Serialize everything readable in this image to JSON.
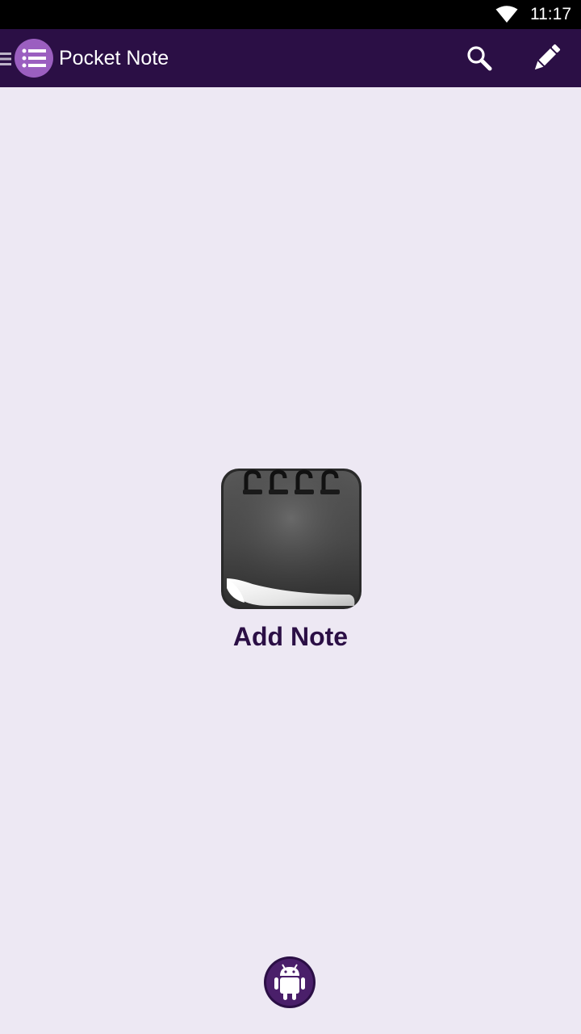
{
  "status_bar": {
    "time": "11:17",
    "icons": [
      "wifi-icon"
    ]
  },
  "app_bar": {
    "title": "Pocket Note",
    "logo_icon": "list-icon",
    "actions": [
      "search-icon",
      "pencil-icon"
    ]
  },
  "main": {
    "add_note_label": "Add Note",
    "add_note_icon": "notepad-icon"
  },
  "bottom": {
    "icon": "android-icon"
  },
  "colors": {
    "status_bar": "#000000",
    "app_bar": "#2b0f45",
    "background": "#ede8f3",
    "accent": "#9b5fc0",
    "label": "#2b0f45"
  }
}
